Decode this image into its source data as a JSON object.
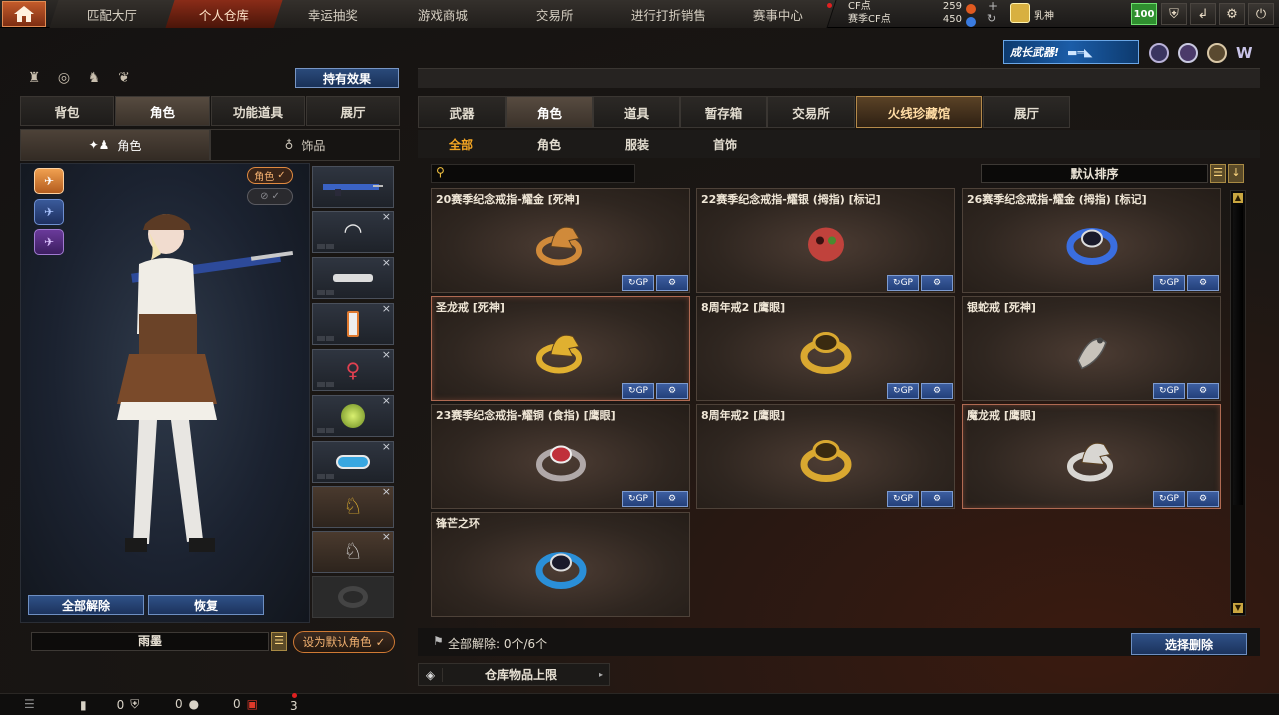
{
  "top_nav": {
    "tabs": [
      "匹配大厅",
      "个人仓库",
      "幸运抽奖",
      "游戏商城",
      "交易所",
      "进行打折销售",
      "赛事中心"
    ],
    "active_index": 1,
    "cf_label": "CF点",
    "cf_value": "259",
    "season_cf_label": "赛季CF点",
    "season_cf_value": "450",
    "plus": "+",
    "username": "乳神",
    "level": "100",
    "icons": [
      "home-icon",
      "shield-icon",
      "exit-icon",
      "settings-icon",
      "power-icon"
    ]
  },
  "header": {
    "growth_banner": "成长武器!",
    "hold_effect": "持有效果"
  },
  "left_panel": {
    "tabs": [
      "背包",
      "角色",
      "功能道具",
      "展厅"
    ],
    "active_tab": 1,
    "subtabs": [
      "角色",
      "饰品"
    ],
    "toggles": [
      "角色",
      "✓"
    ],
    "clear_all": "全部解除",
    "restore": "恢复",
    "character_name": "雨墨",
    "set_default": "设为默认角色"
  },
  "right_panel": {
    "tabs": [
      "武器",
      "角色",
      "道具",
      "暂存箱",
      "交易所",
      "火线珍藏馆",
      "展厅"
    ],
    "active_tab": 1,
    "gold_tab": 5,
    "filters": [
      "全部",
      "角色",
      "服装",
      "首饰"
    ],
    "active_filter": 0,
    "search_placeholder": "",
    "sort_label": "默认排序",
    "items": [
      {
        "name": "20赛季纪念戒指-耀金 [死神]",
        "kind": "dragon",
        "color": "#d08a3a",
        "hl": false,
        "buttons": true
      },
      {
        "name": "22赛季纪念戒指-耀银 (拇指) [标记]",
        "kind": "skull",
        "color": "#c0423c",
        "hl": false,
        "buttons": true
      },
      {
        "name": "26赛季纪念戒指-耀金 (拇指) [标记]",
        "kind": "band",
        "color": "#3a6ee0",
        "hl": false,
        "buttons": true
      },
      {
        "name": "圣龙戒 [死神]",
        "kind": "dragon",
        "color": "#e0b030",
        "hl": true,
        "buttons": true
      },
      {
        "name": "8周年戒2 [鹰眼]",
        "kind": "eight",
        "color": "#d9a830",
        "hl": false,
        "buttons": true
      },
      {
        "name": "银蛇戒 [死神]",
        "kind": "snake",
        "color": "#c8c3bb",
        "hl": false,
        "buttons": true
      },
      {
        "name": "23赛季纪念戒指-耀铜 (食指) [鹰眼]",
        "kind": "gem",
        "color": "#c0303a",
        "hl": false,
        "buttons": true
      },
      {
        "name": "8周年戒2 [鹰眼]",
        "kind": "eight",
        "color": "#d9a830",
        "hl": false,
        "buttons": true
      },
      {
        "name": "魔龙戒 [鹰眼]",
        "kind": "dragon",
        "color": "#d8d6d2",
        "hl": true,
        "buttons": true
      },
      {
        "name": "锋芒之环",
        "kind": "band",
        "color": "#2a8fd8",
        "hl": false,
        "buttons": false
      }
    ],
    "card_btn_exchange": "GP",
    "card_btn_settings": "⚙",
    "bulk_clear": "全部解除: 0个/6个",
    "select_delete": "选择删除",
    "storage_limit": "仓库物品上限"
  },
  "bottom_bar": {
    "count1": "0",
    "count2": "0",
    "count3": "0",
    "count4": "3"
  }
}
